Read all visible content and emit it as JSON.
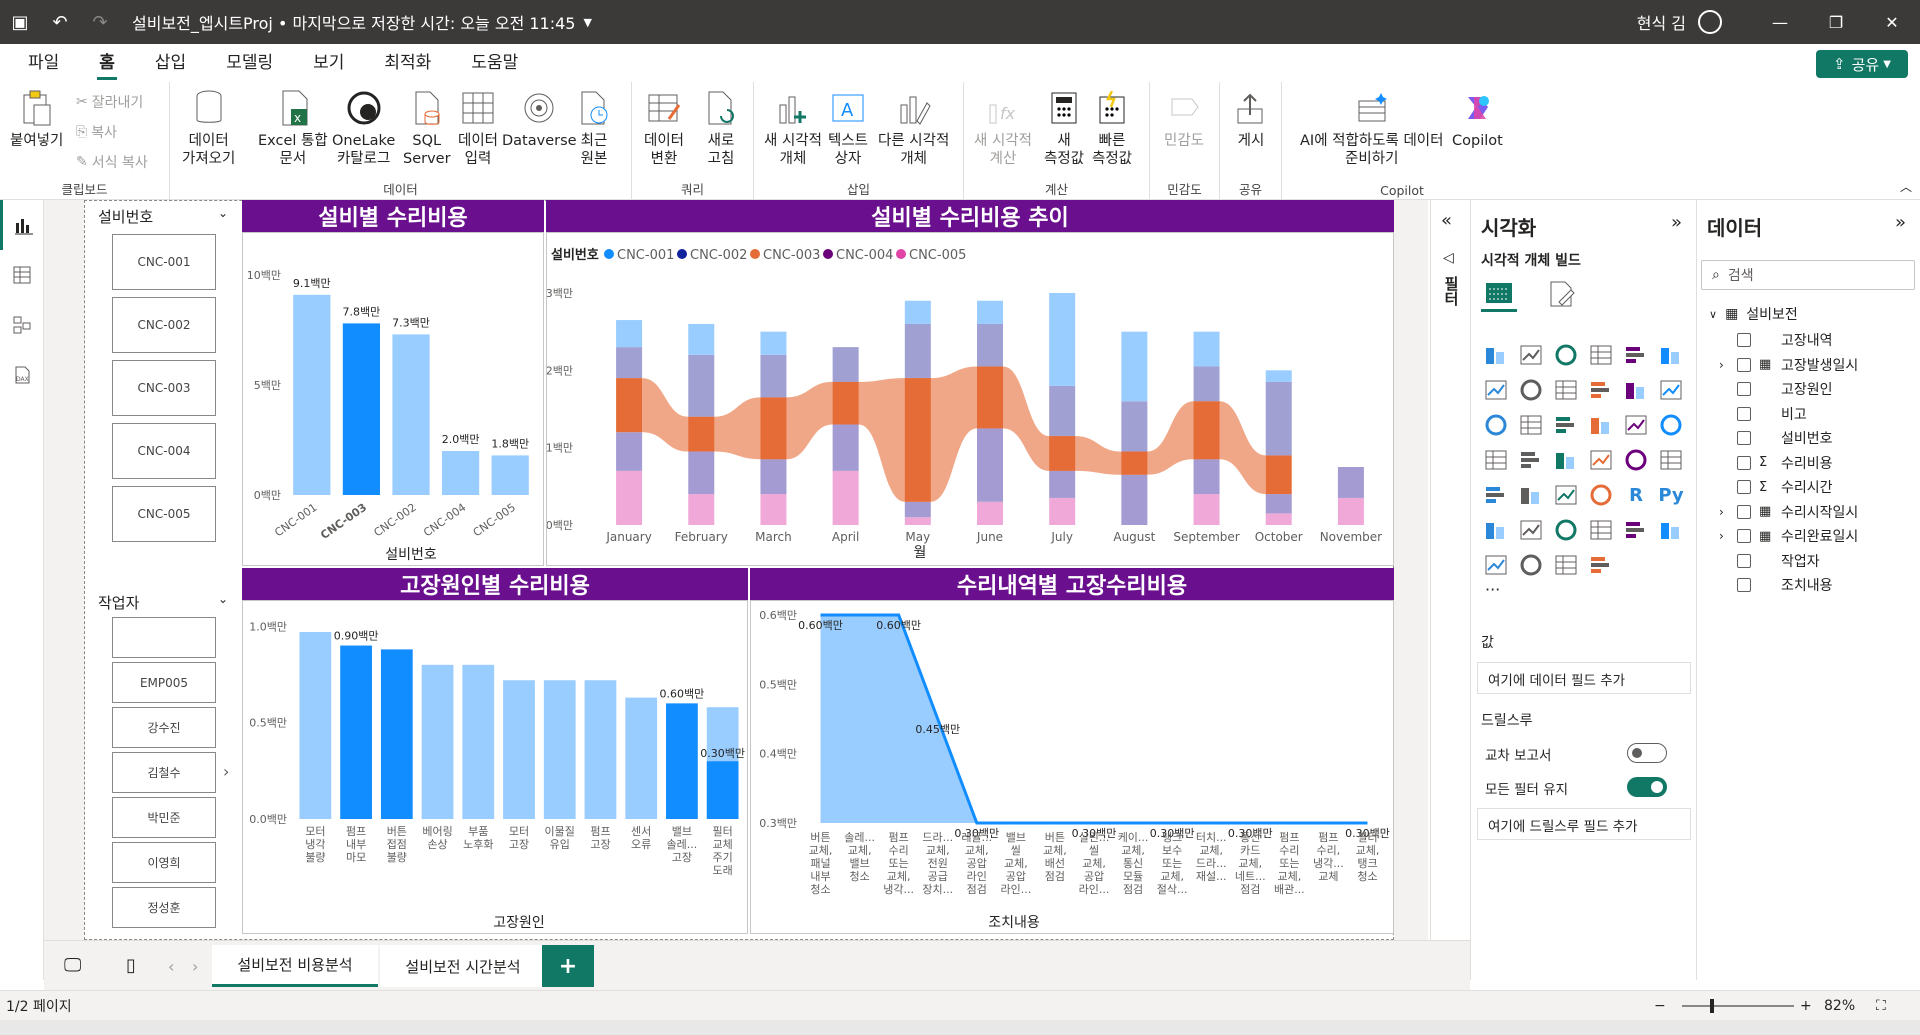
{
  "titlebar": {
    "title": "설비보전_엡시트Proj • 마지막으로 저장한 시간: 오늘 오전 11:45",
    "user": "현식 김"
  },
  "menu": [
    "파일",
    "홈",
    "삽입",
    "모델링",
    "보기",
    "최적화",
    "도움말"
  ],
  "share_label": "공유",
  "ribbon": {
    "paste": "붙여넣기",
    "cut": "잘라내기",
    "copy": "복사",
    "format_painter": "서식 복사",
    "clipboard_group": "클립보드",
    "get_data": "데이터\n가져오기",
    "excel": "Excel 통합\n문서",
    "onelake": "OneLake\n카탈로그",
    "sql": "SQL\nServer",
    "enter_data": "데이터\n입력",
    "dataverse": "Dataverse",
    "recent": "최근\n원본",
    "data_group": "데이터",
    "transform": "데이터\n변환",
    "refresh": "새로\n고침",
    "query_group": "쿼리",
    "new_visual": "새 시각적\n개체",
    "textbox": "텍스트\n상자",
    "more_visuals": "다른 시각적\n개체",
    "insert_group": "삽입",
    "new_calc": "새 시각적\n계산",
    "new_measure": "새\n측정값",
    "quick_measure": "빠른\n측정값",
    "calc_group": "계산",
    "sensitivity": "민감도",
    "sensitivity_group": "민감도",
    "publish": "게시",
    "share_group": "공유",
    "ai_prepare": "AI에 적합하도록 데이터\n준비하기",
    "copilot": "Copilot",
    "copilot_group": "Copilot"
  },
  "slicers": {
    "equipment": {
      "title": "설비번호",
      "items": [
        "CNC-001",
        "CNC-002",
        "CNC-003",
        "CNC-004",
        "CNC-005"
      ]
    },
    "worker": {
      "title": "작업자",
      "items": [
        "",
        "EMP005",
        "강수진",
        "김철수",
        "박민준",
        "이영희",
        "정성훈"
      ]
    }
  },
  "visual_titles": {
    "v1": "설비별 수리비용",
    "v2": "설비별 수리비용 추이",
    "v3": "고장원인별 수리비용",
    "v4": "수리내역별 고장수리비용"
  },
  "chart_data": [
    {
      "type": "bar",
      "title": "설비별 수리비용",
      "categories": [
        "CNC-001",
        "CNC-003",
        "CNC-002",
        "CNC-004",
        "CNC-005"
      ],
      "values": [
        9.1,
        7.8,
        7.3,
        2.0,
        1.8
      ],
      "value_labels": [
        "9.1백만",
        "7.8백만",
        "7.3백만",
        "2.0백만",
        "1.8백만"
      ],
      "xlabel": "설비번호",
      "yticks": [
        "0백만",
        "5백만",
        "10백만"
      ],
      "ylim": [
        0,
        10
      ],
      "highlight_index": 1
    },
    {
      "type": "area",
      "title": "설비별 수리비용 추이",
      "subtype": "ribbon",
      "legend_title": "설비번호",
      "series_names": [
        "CNC-001",
        "CNC-002",
        "CNC-003",
        "CNC-004",
        "CNC-005"
      ],
      "series_colors": [
        "#118dff",
        "#12239e",
        "#e66c37",
        "#6b007b",
        "#e044a7"
      ],
      "categories": [
        "January",
        "February",
        "March",
        "April",
        "May",
        "June",
        "July",
        "August",
        "September",
        "October",
        "November"
      ],
      "stacks": [
        [
          0.35,
          0.4,
          0.7,
          0.5,
          0.7
        ],
        [
          0.4,
          0.8,
          0.45,
          0.55,
          0.4
        ],
        [
          0.3,
          0.55,
          0.8,
          0.45,
          0.4
        ],
        [
          0,
          0.45,
          0.55,
          0.6,
          0.7
        ],
        [
          0.3,
          0.7,
          1.6,
          0.2,
          0.1
        ],
        [
          0.3,
          0.55,
          0.8,
          0.95,
          0.3
        ],
        [
          1.2,
          0.65,
          0.45,
          0.35,
          0.35
        ],
        [
          0.9,
          0.65,
          0.3,
          0.65,
          0
        ],
        [
          0.45,
          0.45,
          0.75,
          0.45,
          0.4
        ],
        [
          0.15,
          0.95,
          0.5,
          0.25,
          0.15
        ],
        [
          0,
          0,
          0,
          0.4,
          0.35
        ]
      ],
      "xlabel": "월",
      "yticks": [
        "0백만",
        "1백만",
        "2백만",
        "3백만"
      ],
      "ylim": [
        0,
        3
      ]
    },
    {
      "type": "bar",
      "title": "고장원인별 수리비용",
      "categories": [
        "모터\n냉각\n불량",
        "펌프\n내부\n마모",
        "버튼\n접점\n불량",
        "베어링\n손상",
        "부품\n노후화",
        "모터\n고장",
        "이물질\n유입",
        "펌프\n고장",
        "센서\n오류",
        "밸브\n솔레...\n고장",
        "필터\n교체\n주기\n도래"
      ],
      "values": [
        0.97,
        0.9,
        0.88,
        0.8,
        0.8,
        0.72,
        0.72,
        0.72,
        0.63,
        0.6,
        0.58
      ],
      "value_labels": [
        "",
        "0.90백만",
        "",
        "",
        "",
        "",
        "",
        "",
        "",
        "0.60백만",
        "0.30백만"
      ],
      "highlight_indices": [
        1,
        2,
        9,
        10
      ],
      "split_last": 0.3,
      "xlabel": "고장원인",
      "yticks": [
        "0.0백만",
        "0.5백만",
        "1.0백만"
      ],
      "ylim": [
        0,
        1.1
      ]
    },
    {
      "type": "area",
      "title": "수리내역별 고장수리비용",
      "categories": [
        "버튼\n교체,\n패널\n내부\n청소",
        "솔레...\n교체,\n밸브\n청소",
        "펌프\n수리\n또는\n교체,\n냉각...",
        "드라...\n교체,\n전원\n공급\n장치...",
        "레귤...\n교체,\n공압\n라인\n점검",
        "밸브\n씰\n교체,\n공압\n라인...",
        "버튼\n교체,\n배선\n점검",
        "실린...\n씰\n교체,\n공압\n라인...",
        "케이...\n교체,\n통신\n모듈\n점검",
        "탱크\n보수\n또는\n교체,\n절삭...",
        "터치...\n교체,\n드라...\n재설...",
        "통신\n카드\n교체,\n네트...\n점검",
        "펌프\n수리\n또는\n교체,\n배관...",
        "펌프\n수리,\n냉각...\n교체",
        "필터\n교체,\n탱크\n청소"
      ],
      "values": [
        0.6,
        0.6,
        0.6,
        0.45,
        0.3,
        0.3,
        0.3,
        0.3,
        0.3,
        0.3,
        0.3,
        0.3,
        0.3,
        0.3,
        0.3
      ],
      "value_labels": [
        "0.60백만",
        "",
        "0.60백만",
        "0.45백만",
        "0.30백만",
        "",
        "",
        "0.30백만",
        "",
        "0.30백만",
        "",
        "0.30백만",
        "",
        "",
        "0.30백만"
      ],
      "xlabel": "조치내용",
      "yticks": [
        "0.3백만",
        "0.4백만",
        "0.5백만",
        "0.6백만"
      ],
      "ylim": [
        0.3,
        0.6
      ]
    }
  ],
  "vispane": {
    "title": "시각화",
    "subtitle": "시각적 개체 빌드",
    "values_label": "값",
    "add_field": "여기에 데이터 필드 추가",
    "drill_label": "드릴스루",
    "cross_report": "교차 보고서",
    "keep_filters": "모든 필터 유지",
    "add_drill": "여기에 드릴스루 필드 추가",
    "filters_tab": "필터"
  },
  "datapane": {
    "title": "데이터",
    "search_placeholder": "검색",
    "table": "설비보전",
    "fields": [
      "고장내역",
      "고장발생일시",
      "고장원인",
      "비고",
      "설비번호",
      "수리비용",
      "수리시간",
      "수리시작일시",
      "수리완료일시",
      "작업자",
      "조치내용"
    ]
  },
  "tabs": [
    "설비보전 비용분석",
    "설비보전 시간분석"
  ],
  "status": {
    "page": "1/2 페이지",
    "zoom": "82%"
  },
  "colors": {
    "accent": "#117865",
    "title_bg": "#6a0f8e",
    "bar_light": "#99ccff",
    "bar_dark": "#118dff"
  }
}
